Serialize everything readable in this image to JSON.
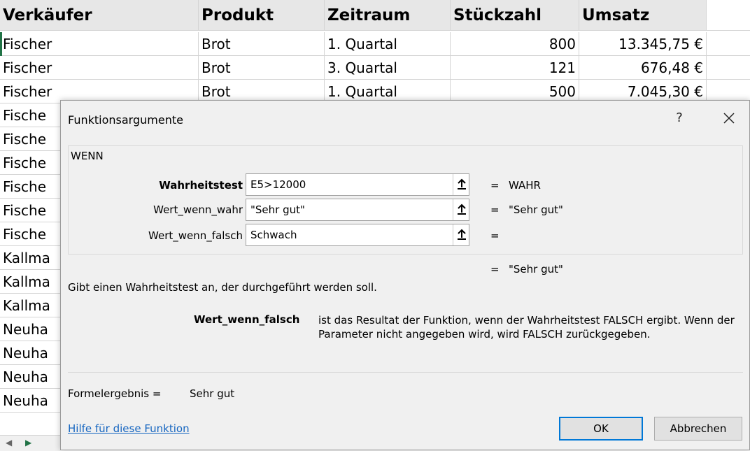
{
  "sheet": {
    "headers": [
      "Verkäufer",
      "Produkt",
      "Zeitraum",
      "Stückzahl",
      "Umsatz"
    ],
    "rows": [
      [
        "Fischer",
        "Brot",
        "1. Quartal",
        "800",
        "13.345,75 €"
      ],
      [
        "Fischer",
        "Brot",
        "3. Quartal",
        "121",
        "676,48 €"
      ],
      [
        "Fischer",
        "Brot",
        "1. Quartal",
        "500",
        "7.045,30 €"
      ],
      [
        "Fische",
        "",
        "",
        "",
        ""
      ],
      [
        "Fische",
        "",
        "",
        "",
        ""
      ],
      [
        "Fische",
        "",
        "",
        "",
        ""
      ],
      [
        "Fische",
        "",
        "",
        "",
        ""
      ],
      [
        "Fische",
        "",
        "",
        "",
        ""
      ],
      [
        "Fische",
        "",
        "",
        "",
        ""
      ],
      [
        "Kallma",
        "",
        "",
        "",
        ""
      ],
      [
        "Kallma",
        "",
        "",
        "",
        ""
      ],
      [
        "Kallma",
        "",
        "",
        "",
        ""
      ],
      [
        "Neuha",
        "",
        "",
        "",
        ""
      ],
      [
        "Neuha",
        "",
        "",
        "",
        ""
      ],
      [
        "Neuha",
        "",
        "",
        "",
        ""
      ],
      [
        "Neuha",
        "",
        "",
        "",
        ""
      ]
    ]
  },
  "dialog": {
    "title": "Funktionsargumente",
    "help_glyph": "?",
    "function_name": "WENN",
    "args": [
      {
        "label": "Wahrheitstest",
        "value": "E5>12000",
        "equals": "=",
        "result": "WAHR"
      },
      {
        "label": "Wert_wenn_wahr",
        "value": "\"Sehr gut\"",
        "equals": "=",
        "result": "\"Sehr gut\""
      },
      {
        "label": "Wert_wenn_falsch",
        "value": "Schwach",
        "equals": "=",
        "result": ""
      }
    ],
    "overall_equals": "=",
    "overall_result": "\"Sehr gut\"",
    "description": "Gibt einen Wahrheitstest an, der durchgeführt werden soll.",
    "param_name": "Wert_wenn_falsch",
    "param_description": "ist das Resultat der Funktion, wenn der Wahrheitstest FALSCH ergibt. Wenn der Parameter nicht angegeben wird, wird FALSCH zurückgegeben.",
    "formula_result_label": "Formelergebnis =",
    "formula_result_value": "Sehr gut",
    "help_link": "Hilfe für diese Funktion",
    "ok_label": "OK",
    "cancel_label": "Abbrechen"
  },
  "colors": {
    "header_bg": "#e7e7e7",
    "dialog_bg": "#f0f0f0",
    "link": "#1565c0",
    "focus_border": "#0078d7",
    "selection": "#217346"
  }
}
